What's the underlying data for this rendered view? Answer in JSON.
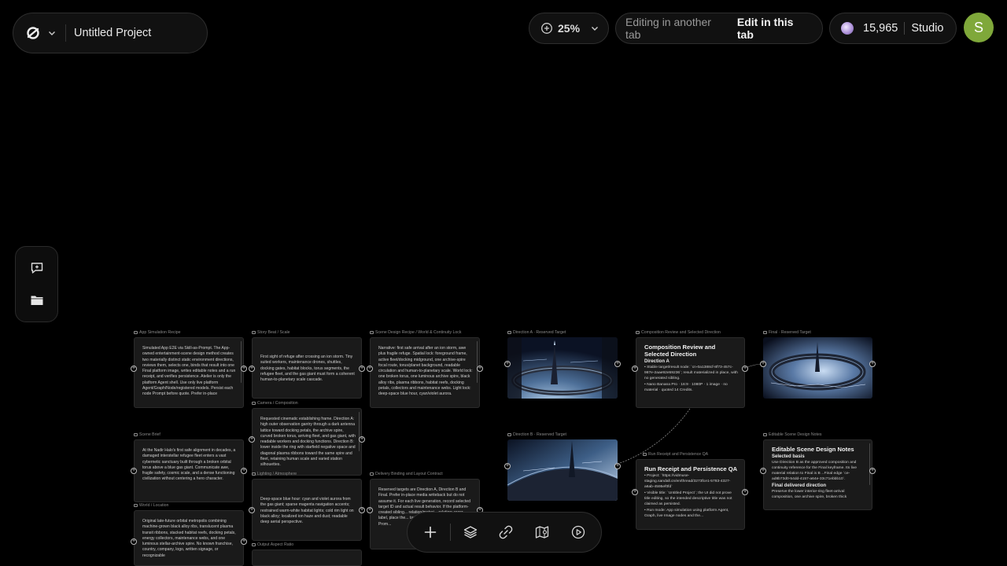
{
  "header": {
    "project_title": "Untitled Project",
    "zoom": "25%",
    "edit_notice": "Editing in another tab",
    "edit_action": "Edit in this tab",
    "credits": "15,965",
    "plan": "Studio",
    "avatar_initial": "S"
  },
  "colors": {
    "background": "#000000",
    "avatar": "#7fa83a",
    "node_bg": "#1a1a1a"
  },
  "left_dock": {
    "items": [
      "feedback-icon",
      "folder-icon"
    ]
  },
  "toolbar": {
    "items": [
      "add-icon",
      "layers-icon",
      "link-icon",
      "map-icon",
      "play-icon"
    ]
  },
  "nodes": {
    "app_sim": {
      "label": "App Simulation Recipe",
      "text": "Simulated App E2E via Skill-as-Prompt. The App-owned entertainment-scene design method creates two materially distinct static environment directions, reviews them, selects one, binds that result into one Final platform image, writes editable notes and a run receipt, and verifies persistence. Atelier is only the platform Agent shell. Use only live platform Agent/Graph/Node/registered models. Persist each node Prompt before quote. Prefer in-place"
    },
    "story_beat": {
      "label": "Story Beat / Scale",
      "text": "First sight of refuge after crossing an ion storm. Tiny suited workers, maintenance drones, shuttles, docking gates, habitat blocks, torus segments, the refugee fleet, and the gas giant must form a coherent human-to-planetary scale cascade."
    },
    "camera": {
      "label": "Camera / Composition",
      "text": "Requested cinematic establishing frame. Direction A: high outer observation gantry through a dark antenna lattice toward docking petals, the archive spire, curved broken torus, arriving fleet, and gas giant, with readable workers and docking functions. Direction B: lower inside the ring with starfield negative space and diagonal plasma ribbons toward the same spire and fleet, retaining human scale and varied station silhouettes."
    },
    "scene_recipe": {
      "label": "Scene Design Recipe / World & Continuity Lock",
      "text": "Narrative: first safe arrival after an ion storm, awe plus fragile refuge. Spatial lock: foreground frame, active fleet/docking midground, one archive-spire focal route, torus/planet background, readable circulation and human-to-planetary scale. World lock: one broken torus, one luminous archive spire, black alloy ribs, plasma ribbons, habitat reefs, docking petals, collectors and maintenance webs. Light lock: deep-space blue hour, cyan/violet aurora."
    },
    "dir_a": {
      "label": "Direction A · Reserved Target"
    },
    "dir_b": {
      "label": "Direction B · Reserved Target"
    },
    "final": {
      "label": "Final · Reserved Target"
    },
    "comp_review": {
      "label": "Composition Review and Selected Direction",
      "title": "Composition Review and Selected Direction",
      "sub": "Direction A",
      "items": [
        "Stable target/result node: `cn-0a1388cf-8f73-457c-987e-2aae92e59236`; result materialized in place, with no generated sibling.",
        "Nano Banana Pro · 16:9 · 1080P · 1 image · no material · quoted 14 Credits."
      ]
    },
    "scene_brief": {
      "label": "Scene Brief",
      "text": "At the Nadir Halo's first safe alignment in decades, a damaged interstellar refugee fleet enters a vast cybernetic sanctuary built through a broken orbital torus above a blue gas giant. Communicate awe, fragile safety, cosmic scale, and a dense functioning civilization without centering a hero character."
    },
    "world": {
      "label": "World / Location",
      "text": "Original late-future orbital metropolis combining machine-grown black alloy ribs, translucent plasma transit ribbons, stacked habitat reefs, docking petals, energy collectors, maintenance webs, and one luminous stellar-archive spire. No known franchise, country, company, logo, written signage, or recognizable"
    },
    "lighting": {
      "label": "Lighting / Atmosphere",
      "text": "Deep-space blue hour: cyan and violet aurora from the gas giant; sparse magenta navigation accents; restrained warm-white habitat lights; cold rim light on black alloy; localized ion haze and dust; readable deep aerial perspective."
    },
    "output_ratio": {
      "label": "Output Aspect Ratio"
    },
    "delivery": {
      "label": "Delivery Binding and Layout Contract",
      "text": "Reserved targets are Direction A, Direction B and Final. Prefer in-place media writeback but do not assume it. For each live generation, record selected target ID and actual result behavior. If the platform-created sibling... relation/materi... relation; recor... label, place the... target SUPERSE... the scoped Prom..."
    },
    "run_receipt": {
      "label": "Run Receipt and Persistence QA",
      "title": "Run Receipt and Persistence QA",
      "items": [
        "Project: `https://vidmuse-staging.sandall.cn/en/thread/3273fce1-5783-4327-a6ab-4595ef0fd`",
        "Visible title: `Untitled Project`; the UI did not prove title editing, so the intended descriptive title was not claimed as persisted.",
        "Run mode: App simulation using platform Agent, Graph, live Image nodes and the..."
      ]
    },
    "design_notes": {
      "label": "Editable Scene Design Notes",
      "title": "Editable Scene Design Notes",
      "sub1": "Selected basis",
      "text1": "Use Direction B as the approved composition and continuity reference for the Final keyframe. Its live material relation to Final is B→Final edge `ce-ad8b73d0-54dd-4157-a64e-33c71ebbb10`.",
      "sub2": "Final delivered direction",
      "text2": "Preserve the lower interior-ring fleet-arrival composition, one archive spire, broken thick"
    }
  }
}
